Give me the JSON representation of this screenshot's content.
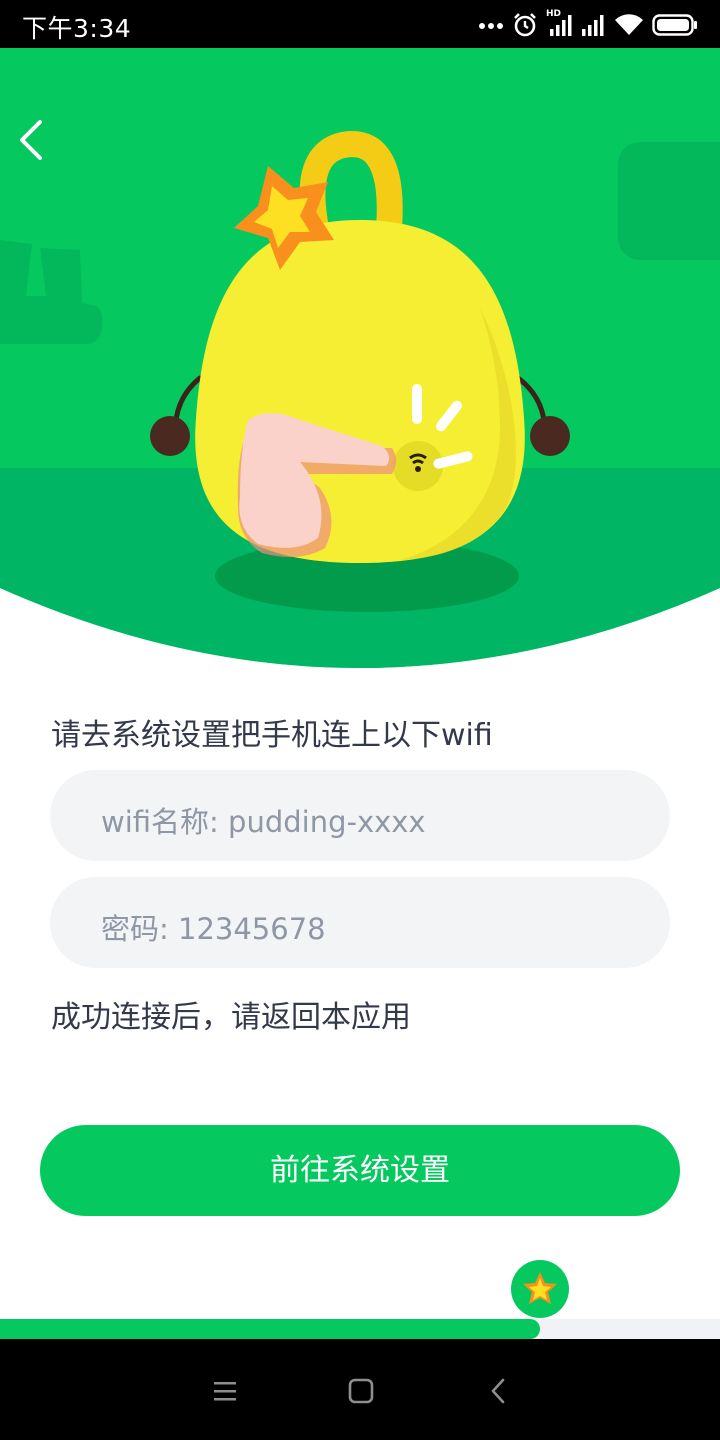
{
  "status_bar": {
    "time": "下午3:34",
    "network_label": "HD",
    "icons": [
      "more-dots-icon",
      "alarm-icon",
      "signal-icon",
      "signal-icon",
      "wifi-icon",
      "battery-icon"
    ]
  },
  "header": {
    "back_icon": "back-arrow-icon"
  },
  "colors": {
    "accent": "#05c95e",
    "hero_dark": "#00b95c",
    "character": "#f5ee32",
    "field_bg": "#f3f4f6",
    "text": "#33384a",
    "placeholder": "#8f97a4"
  },
  "content": {
    "instruction": "请去系统设置把手机连上以下wifi",
    "wifi_name": "wifi名称: pudding-xxxx",
    "password": "密码: 12345678",
    "after_note": "成功连接后，请返回本应用",
    "cta_label": "前往系统设置"
  },
  "progress": {
    "fraction": 0.75
  },
  "nav_bar": {
    "icons": [
      "menu-icon",
      "home-icon",
      "back-icon"
    ]
  }
}
